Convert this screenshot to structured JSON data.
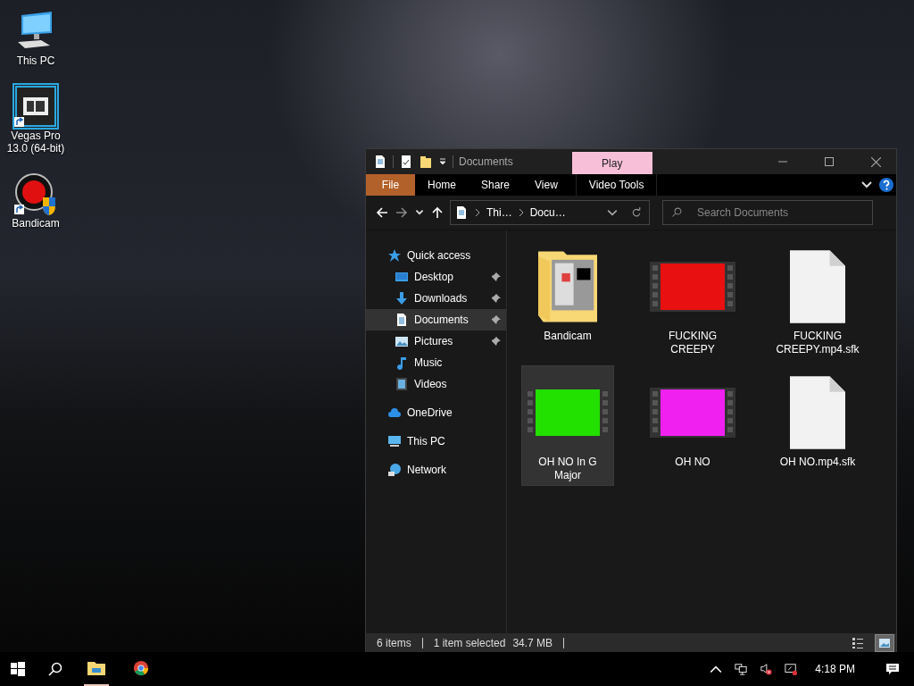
{
  "desktop_icons": [
    {
      "label": "This PC",
      "kind": "pc",
      "selected": false,
      "shortcut": false
    },
    {
      "label": "Vegas Pro 13.0 (64-bit)",
      "kind": "vegas",
      "selected": true,
      "shortcut": true
    },
    {
      "label": "Bandicam",
      "kind": "bandicam",
      "selected": false,
      "shortcut": true
    }
  ],
  "window": {
    "title": "Documents",
    "contextual_tab": "Play",
    "ribbon_tabs": [
      {
        "label": "File",
        "kind": "file",
        "selected": false
      },
      {
        "label": "Home",
        "kind": "tab",
        "selected": false
      },
      {
        "label": "Share",
        "kind": "tab",
        "selected": false
      },
      {
        "label": "View",
        "kind": "tab",
        "selected": false
      },
      {
        "label": "Video Tools",
        "kind": "contextual",
        "selected": false
      }
    ],
    "breadcrumbs": [
      "Thi…",
      "Docu…"
    ],
    "search": {
      "placeholder": "Search Documents"
    },
    "nav": [
      {
        "label": "Quick access",
        "kind": "star",
        "selected": false,
        "children": [
          {
            "label": "Desktop",
            "kind": "desktop",
            "selected": false,
            "pinned": true
          },
          {
            "label": "Downloads",
            "kind": "download",
            "selected": false,
            "pinned": true
          },
          {
            "label": "Documents",
            "kind": "document",
            "selected": true,
            "pinned": true
          },
          {
            "label": "Pictures",
            "kind": "picture",
            "selected": false,
            "pinned": true
          },
          {
            "label": "Music",
            "kind": "music",
            "selected": false,
            "pinned": false
          },
          {
            "label": "Videos",
            "kind": "video",
            "selected": false,
            "pinned": false
          }
        ]
      },
      {
        "label": "OneDrive",
        "kind": "cloud",
        "selected": false
      },
      {
        "label": "This PC",
        "kind": "pc",
        "selected": false
      },
      {
        "label": "Network",
        "kind": "network",
        "selected": false
      }
    ],
    "files": [
      {
        "name": "Bandicam",
        "kind": "folder",
        "selected": false
      },
      {
        "name": "FUCKING CREEPY",
        "kind": "video",
        "color": "#e81010",
        "selected": false
      },
      {
        "name": "FUCKING CREEPY.mp4.sfk",
        "kind": "file",
        "selected": false
      },
      {
        "name": "OH NO In G Major",
        "kind": "video",
        "color": "#22e000",
        "selected": true
      },
      {
        "name": "OH NO",
        "kind": "video",
        "color": "#f020f0",
        "selected": false
      },
      {
        "name": "OH NO.mp4.sfk",
        "kind": "file",
        "selected": false
      }
    ],
    "status_bar": {
      "item_count": "6 items",
      "selection": "1 item selected",
      "size": "34.7 MB"
    },
    "views": [
      {
        "kind": "details",
        "selected": false
      },
      {
        "kind": "large-icons",
        "selected": true
      }
    ]
  },
  "taskbar": {
    "apps": [
      {
        "kind": "explorer",
        "active": true
      },
      {
        "kind": "chrome",
        "active": false
      }
    ],
    "time": "4:18 PM"
  }
}
